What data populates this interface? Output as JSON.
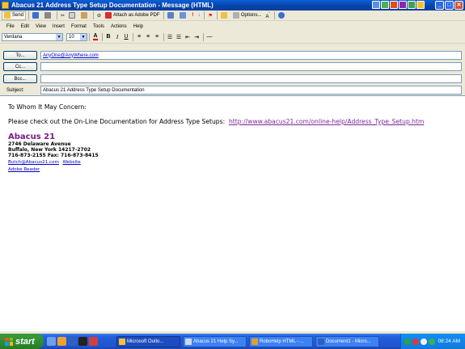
{
  "window": {
    "title": "Abacus 21 Address Type Setup Documentation - Message (HTML)",
    "controls": [
      "minimize",
      "maximize",
      "close"
    ]
  },
  "toolbar_main": {
    "send_label": "Send",
    "attach_pdf_label": "Attach as Adobe PDF",
    "options_label": "Options..."
  },
  "menubar": {
    "items": [
      {
        "label": "File"
      },
      {
        "label": "Edit"
      },
      {
        "label": "View"
      },
      {
        "label": "Insert"
      },
      {
        "label": "Format"
      },
      {
        "label": "Tools"
      },
      {
        "label": "Actions"
      },
      {
        "label": "Help"
      }
    ]
  },
  "format_toolbar": {
    "font": "Verdana",
    "size": "10",
    "bold": "B",
    "italic": "I",
    "underline": "U"
  },
  "header": {
    "to_label": "To...",
    "to_value": "AnyOne@AnyWhere.com",
    "cc_label": "Cc...",
    "cc_value": "",
    "bcc_label": "Bcc...",
    "bcc_value": "",
    "subject_label": "Subject:",
    "subject_value": "Abacus 21 Address Type Setup Documentation"
  },
  "body": {
    "greeting": "To Whom It May Concern:",
    "intro": "Please check out the On-Line Documentation for Address Type Setups:",
    "link": "http://www.abacus21.com/online-help/Address_Type_Setup.htm",
    "signature": {
      "name": "Abacus 21",
      "street": "2746 Delaware Avenue",
      "city": "Buffalo, New York  14217-2702",
      "phones": "716-873-2155  Fax: 716-873-8415",
      "email": "Butch@Abacus21.com",
      "website": "Website",
      "reader": "Adobe Reader"
    }
  },
  "taskbar": {
    "start_label": "start",
    "tasks": [
      {
        "label": "Microsoft Outlo...",
        "active": true
      },
      {
        "label": "Abacus 21 Help Sy...",
        "active": false
      },
      {
        "label": "RoboHelp HTML - ...",
        "active": false
      },
      {
        "label": "Document1 - Micro...",
        "active": false
      }
    ],
    "clock": "08:24 AM"
  },
  "colors": {
    "title_bar": "#0842a8",
    "signature_name": "#7a1a8c",
    "visited_link": "#7a2a9a",
    "link": "#0000cc"
  }
}
